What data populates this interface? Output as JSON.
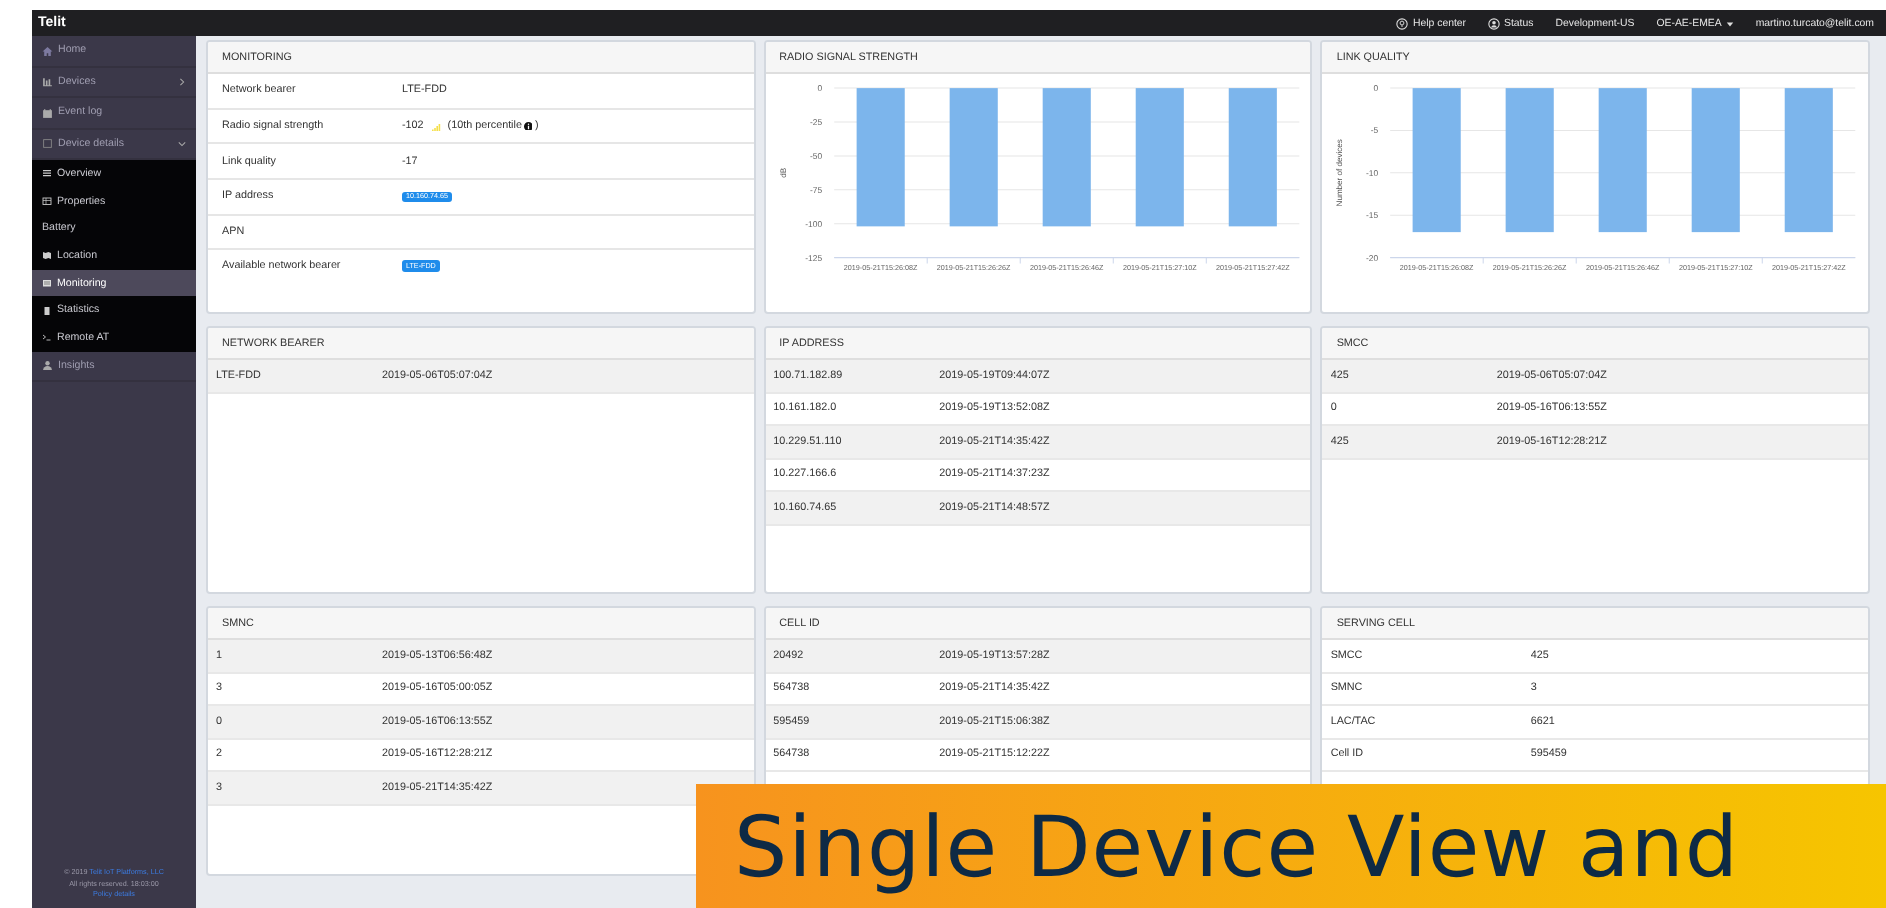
{
  "topbar": {
    "logo": "Telit",
    "items": [
      {
        "kind": "help",
        "label": "Help center"
      },
      {
        "kind": "status",
        "label": "Status"
      },
      {
        "kind": "plain",
        "label": "Development-US"
      },
      {
        "kind": "dropdown",
        "label": "OE-AE-EMEA"
      },
      {
        "kind": "plain",
        "label": "martino.turcato@telit.com"
      }
    ]
  },
  "sidebar": {
    "items": [
      {
        "label": "Home",
        "selected": false
      },
      {
        "label": "Devices",
        "selected": false,
        "expandable": true
      },
      {
        "label": "Event log",
        "selected": false
      },
      {
        "label": "Device details",
        "selected": false,
        "expanded": true,
        "children": [
          {
            "label": "Overview",
            "selected": false
          },
          {
            "label": "Properties",
            "selected": false
          },
          {
            "label": "Battery",
            "selected": false
          },
          {
            "label": "Location",
            "selected": false
          },
          {
            "label": "Monitoring",
            "selected": true
          },
          {
            "label": "Statistics",
            "selected": false
          },
          {
            "label": "Remote AT",
            "selected": false
          }
        ]
      },
      {
        "label": "Insights",
        "selected": false
      }
    ],
    "footer": {
      "copyright": "© 2019",
      "company_link": "Telit IoT Platforms, LLC",
      "rights": "All rights reserved. 18:03:00",
      "policy_link": "Policy details"
    }
  },
  "monitoring": {
    "title": "MONITORING",
    "rows": [
      {
        "kind": "text",
        "label": "Network bearer",
        "value": "LTE-FDD"
      },
      {
        "kind": "signal",
        "label": "Radio signal strength",
        "value": "-102",
        "note": "(10th percentile",
        "note_end": ")"
      },
      {
        "kind": "text",
        "label": "Link quality",
        "value": "-17"
      },
      {
        "kind": "badge",
        "label": "IP address",
        "value": "10.160.74.65"
      },
      {
        "kind": "text",
        "label": "APN"
      },
      {
        "kind": "badge",
        "label": "Available network bearer",
        "value": "LTE-FDD"
      }
    ]
  },
  "charts": [
    {
      "title": "RADIO SIGNAL STRENGTH",
      "chart_data": {
        "type": "bar",
        "ylabel": "dB",
        "categories": [
          "2019-05-21T15:26:08Z",
          "2019-05-21T15:26:26Z",
          "2019-05-21T15:26:46Z",
          "2019-05-21T15:27:10Z",
          "2019-05-21T15:27:42Z"
        ],
        "series": [
          {
            "color": "#7cb5ec",
            "values": [
              -102,
              -102,
              -102,
              -102,
              -102
            ]
          }
        ],
        "grid": true,
        "ylim": [
          -125,
          0
        ],
        "yticks": [
          0,
          -25,
          -50,
          -75,
          -100,
          -125
        ]
      }
    },
    {
      "title": "LINK QUALITY",
      "chart_data": {
        "type": "bar",
        "ylabel": "Number of devices",
        "categories": [
          "2019-05-21T15:26:08Z",
          "2019-05-21T15:26:26Z",
          "2019-05-21T15:26:46Z",
          "2019-05-21T15:27:10Z",
          "2019-05-21T15:27:42Z"
        ],
        "series": [
          {
            "color": "#7cb5ec",
            "values": [
              -17,
              -17,
              -17,
              -17,
              -17
            ]
          }
        ],
        "grid": true,
        "ylim": [
          -20,
          0
        ],
        "yticks": [
          0,
          -5,
          -10,
          -15,
          -20
        ]
      }
    }
  ],
  "lists": [
    {
      "title": "NETWORK BEARER",
      "striped": true,
      "rows": [
        [
          "LTE-FDD",
          "2019-05-06T05:07:04Z"
        ]
      ]
    },
    {
      "title": "IP ADDRESS",
      "striped": true,
      "rows": [
        [
          "100.71.182.89",
          "2019-05-19T09:44:07Z"
        ],
        [
          "10.161.182.0",
          "2019-05-19T13:52:08Z"
        ],
        [
          "10.229.51.110",
          "2019-05-21T14:35:42Z"
        ],
        [
          "10.227.166.6",
          "2019-05-21T14:37:23Z"
        ],
        [
          "10.160.74.65",
          "2019-05-21T14:48:57Z"
        ]
      ]
    },
    {
      "title": "SMCC",
      "striped": true,
      "rows": [
        [
          "425",
          "2019-05-06T05:07:04Z"
        ],
        [
          "0",
          "2019-05-16T06:13:55Z"
        ],
        [
          "425",
          "2019-05-16T12:28:21Z"
        ]
      ]
    },
    {
      "title": "SMNC",
      "striped": true,
      "rows": [
        [
          "1",
          "2019-05-13T06:56:48Z"
        ],
        [
          "3",
          "2019-05-16T05:00:05Z"
        ],
        [
          "0",
          "2019-05-16T06:13:55Z"
        ],
        [
          "2",
          "2019-05-16T12:28:21Z"
        ],
        [
          "3",
          "2019-05-21T14:35:42Z"
        ]
      ]
    },
    {
      "title": "CELL ID",
      "striped": true,
      "rows": [
        [
          "20492",
          "2019-05-19T13:57:28Z"
        ],
        [
          "564738",
          "2019-05-21T14:35:42Z"
        ],
        [
          "595459",
          "2019-05-21T15:06:38Z"
        ],
        [
          "564738",
          "2019-05-21T15:12:22Z"
        ]
      ]
    },
    {
      "title": "SERVING CELL",
      "striped": false,
      "rows": [
        [
          "SMCC",
          "425"
        ],
        [
          "SMNC",
          "3"
        ],
        [
          "LAC/TAC",
          "6621"
        ],
        [
          "Cell ID",
          "595459"
        ]
      ]
    }
  ],
  "caption": {
    "text": "Single Device View and"
  }
}
